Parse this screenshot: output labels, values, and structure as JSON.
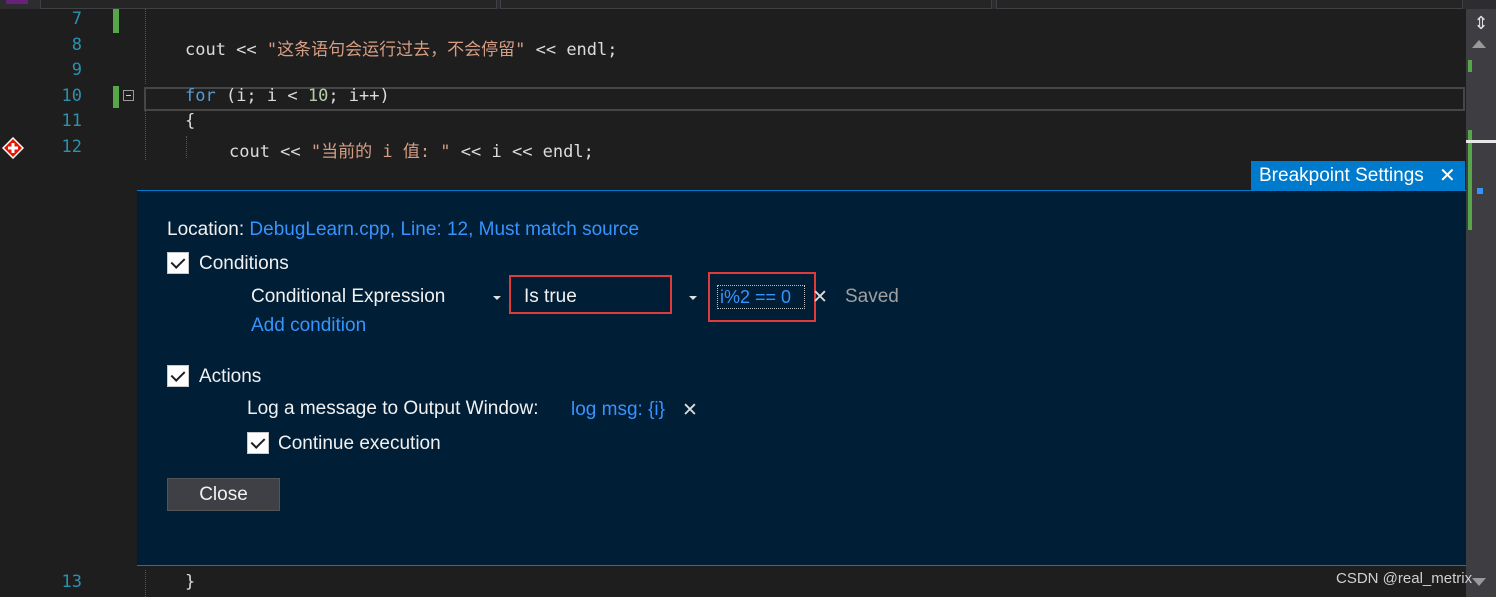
{
  "editor": {
    "line_numbers": {
      "l7": "7",
      "l8": "8",
      "l9": "9",
      "l10": "10",
      "l11": "11",
      "l12": "12",
      "l13": "13"
    },
    "code": {
      "line8_cout": "cout << ",
      "line8_str": "\"这条语句会运行过去，不会停留\"",
      "line8_end": " << endl;",
      "line10_for": "for",
      "line10_a": " (i; i < ",
      "line10_num": "10",
      "line10_b": "; i++)",
      "line11": "{",
      "line12_cout": "cout << ",
      "line12_str": "\"当前的 i 值: \"",
      "line12_end": " << i << endl;",
      "line13": "}"
    }
  },
  "breakpoint_settings": {
    "tab_title": "Breakpoint Settings",
    "location_label": "Location:",
    "location_value": "DebugLearn.cpp, Line: 12, Must match source",
    "conditions_label": "Conditions",
    "conditions_checked": true,
    "condition_type": "Conditional Expression",
    "condition_mode": "Is true",
    "condition_expression": "i%2 == 0",
    "condition_status": "Saved",
    "add_condition_label": "Add condition",
    "actions_label": "Actions",
    "actions_checked": true,
    "log_label": "Log a message to Output Window:",
    "log_message": "log msg: {i}",
    "continue_label": "Continue execution",
    "continue_checked": true,
    "close_label": "Close"
  },
  "watermark": "CSDN @real_metrix",
  "colors": {
    "accent": "#007acc",
    "highlight_border": "#e03a3a",
    "link": "#3794ff",
    "line_number": "#2b91af",
    "keyword": "#569cd6",
    "string": "#d69d85"
  }
}
